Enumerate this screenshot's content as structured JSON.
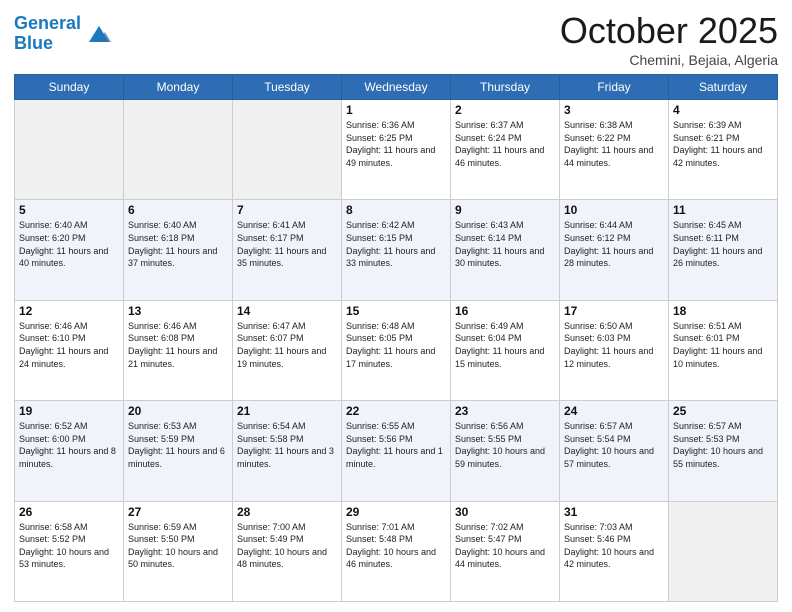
{
  "header": {
    "logo_line1": "General",
    "logo_line2": "Blue",
    "month": "October 2025",
    "location": "Chemini, Bejaia, Algeria"
  },
  "weekdays": [
    "Sunday",
    "Monday",
    "Tuesday",
    "Wednesday",
    "Thursday",
    "Friday",
    "Saturday"
  ],
  "weeks": [
    [
      {
        "day": "",
        "info": ""
      },
      {
        "day": "",
        "info": ""
      },
      {
        "day": "",
        "info": ""
      },
      {
        "day": "1",
        "info": "Sunrise: 6:36 AM\nSunset: 6:25 PM\nDaylight: 11 hours and 49 minutes."
      },
      {
        "day": "2",
        "info": "Sunrise: 6:37 AM\nSunset: 6:24 PM\nDaylight: 11 hours and 46 minutes."
      },
      {
        "day": "3",
        "info": "Sunrise: 6:38 AM\nSunset: 6:22 PM\nDaylight: 11 hours and 44 minutes."
      },
      {
        "day": "4",
        "info": "Sunrise: 6:39 AM\nSunset: 6:21 PM\nDaylight: 11 hours and 42 minutes."
      }
    ],
    [
      {
        "day": "5",
        "info": "Sunrise: 6:40 AM\nSunset: 6:20 PM\nDaylight: 11 hours and 40 minutes."
      },
      {
        "day": "6",
        "info": "Sunrise: 6:40 AM\nSunset: 6:18 PM\nDaylight: 11 hours and 37 minutes."
      },
      {
        "day": "7",
        "info": "Sunrise: 6:41 AM\nSunset: 6:17 PM\nDaylight: 11 hours and 35 minutes."
      },
      {
        "day": "8",
        "info": "Sunrise: 6:42 AM\nSunset: 6:15 PM\nDaylight: 11 hours and 33 minutes."
      },
      {
        "day": "9",
        "info": "Sunrise: 6:43 AM\nSunset: 6:14 PM\nDaylight: 11 hours and 30 minutes."
      },
      {
        "day": "10",
        "info": "Sunrise: 6:44 AM\nSunset: 6:12 PM\nDaylight: 11 hours and 28 minutes."
      },
      {
        "day": "11",
        "info": "Sunrise: 6:45 AM\nSunset: 6:11 PM\nDaylight: 11 hours and 26 minutes."
      }
    ],
    [
      {
        "day": "12",
        "info": "Sunrise: 6:46 AM\nSunset: 6:10 PM\nDaylight: 11 hours and 24 minutes."
      },
      {
        "day": "13",
        "info": "Sunrise: 6:46 AM\nSunset: 6:08 PM\nDaylight: 11 hours and 21 minutes."
      },
      {
        "day": "14",
        "info": "Sunrise: 6:47 AM\nSunset: 6:07 PM\nDaylight: 11 hours and 19 minutes."
      },
      {
        "day": "15",
        "info": "Sunrise: 6:48 AM\nSunset: 6:05 PM\nDaylight: 11 hours and 17 minutes."
      },
      {
        "day": "16",
        "info": "Sunrise: 6:49 AM\nSunset: 6:04 PM\nDaylight: 11 hours and 15 minutes."
      },
      {
        "day": "17",
        "info": "Sunrise: 6:50 AM\nSunset: 6:03 PM\nDaylight: 11 hours and 12 minutes."
      },
      {
        "day": "18",
        "info": "Sunrise: 6:51 AM\nSunset: 6:01 PM\nDaylight: 11 hours and 10 minutes."
      }
    ],
    [
      {
        "day": "19",
        "info": "Sunrise: 6:52 AM\nSunset: 6:00 PM\nDaylight: 11 hours and 8 minutes."
      },
      {
        "day": "20",
        "info": "Sunrise: 6:53 AM\nSunset: 5:59 PM\nDaylight: 11 hours and 6 minutes."
      },
      {
        "day": "21",
        "info": "Sunrise: 6:54 AM\nSunset: 5:58 PM\nDaylight: 11 hours and 3 minutes."
      },
      {
        "day": "22",
        "info": "Sunrise: 6:55 AM\nSunset: 5:56 PM\nDaylight: 11 hours and 1 minute."
      },
      {
        "day": "23",
        "info": "Sunrise: 6:56 AM\nSunset: 5:55 PM\nDaylight: 10 hours and 59 minutes."
      },
      {
        "day": "24",
        "info": "Sunrise: 6:57 AM\nSunset: 5:54 PM\nDaylight: 10 hours and 57 minutes."
      },
      {
        "day": "25",
        "info": "Sunrise: 6:57 AM\nSunset: 5:53 PM\nDaylight: 10 hours and 55 minutes."
      }
    ],
    [
      {
        "day": "26",
        "info": "Sunrise: 6:58 AM\nSunset: 5:52 PM\nDaylight: 10 hours and 53 minutes."
      },
      {
        "day": "27",
        "info": "Sunrise: 6:59 AM\nSunset: 5:50 PM\nDaylight: 10 hours and 50 minutes."
      },
      {
        "day": "28",
        "info": "Sunrise: 7:00 AM\nSunset: 5:49 PM\nDaylight: 10 hours and 48 minutes."
      },
      {
        "day": "29",
        "info": "Sunrise: 7:01 AM\nSunset: 5:48 PM\nDaylight: 10 hours and 46 minutes."
      },
      {
        "day": "30",
        "info": "Sunrise: 7:02 AM\nSunset: 5:47 PM\nDaylight: 10 hours and 44 minutes."
      },
      {
        "day": "31",
        "info": "Sunrise: 7:03 AM\nSunset: 5:46 PM\nDaylight: 10 hours and 42 minutes."
      },
      {
        "day": "",
        "info": ""
      }
    ]
  ]
}
